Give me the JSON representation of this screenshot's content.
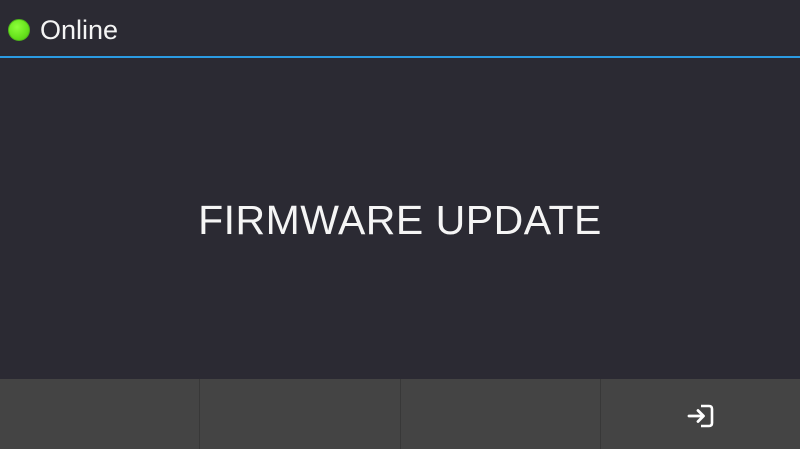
{
  "status": {
    "label": "Online",
    "indicator_color": "#6be51f",
    "accent_color": "#2b9be3"
  },
  "main": {
    "title": "FIRMWARE UPDATE"
  },
  "softkeys": [
    {
      "label": "",
      "icon": ""
    },
    {
      "label": "",
      "icon": ""
    },
    {
      "label": "",
      "icon": ""
    },
    {
      "label": "",
      "icon": "login-icon"
    }
  ]
}
